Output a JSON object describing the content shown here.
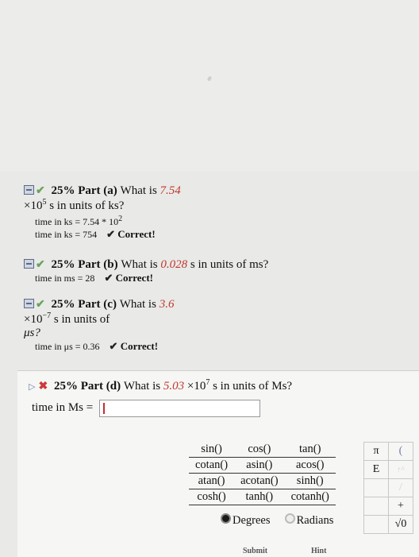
{
  "part_a": {
    "percent": "25%",
    "part_label": "Part (a)",
    "question_start": "What is ",
    "value": "7.54",
    "times": "×10",
    "exponent": "5",
    "question_end": " s in units of ks?",
    "line1": "time in ks = 7.54 * 10",
    "line1_exp": "2",
    "line2": "time in ks = 754",
    "status": "Correct!"
  },
  "part_b": {
    "percent": "25%",
    "part_label": "Part (b)",
    "question_start": "What is ",
    "value": "0.028",
    "question_end": " s in units of ms?",
    "line1": "time in ms = 28",
    "status": "Correct!"
  },
  "part_c": {
    "percent": "25%",
    "part_label": "Part (c)",
    "question_start": "What is ",
    "value": "3.6",
    "times": "×10",
    "exponent": "−7",
    "question_mid": " s in units of",
    "unit": "μs?",
    "line1": "time in μs = 0.36",
    "status": "Correct!"
  },
  "part_d": {
    "percent": "25%",
    "part_label": "Part (d)",
    "question_start": "What is ",
    "value": "5.03",
    "times": " ×10",
    "exponent": "7",
    "question_end": " s in units of Ms?",
    "input_label": "time in Ms =",
    "input_value": ""
  },
  "functions": [
    [
      "sin()",
      "cos()",
      "tan()"
    ],
    [
      "cotan()",
      "asin()",
      "acos()"
    ],
    [
      "atan()",
      "acotan()",
      "sinh()"
    ],
    [
      "cosh()",
      "tanh()",
      "cotanh()"
    ]
  ],
  "keypad": [
    [
      "π",
      "("
    ],
    [
      "E",
      "↑^"
    ],
    [
      "",
      "/"
    ],
    [
      "",
      "+"
    ],
    [
      "",
      "√0"
    ]
  ],
  "angle_modes": {
    "degrees": "Degrees",
    "radians": "Radians"
  },
  "buttons": {
    "submit": "Submit",
    "hint": "Hint"
  }
}
